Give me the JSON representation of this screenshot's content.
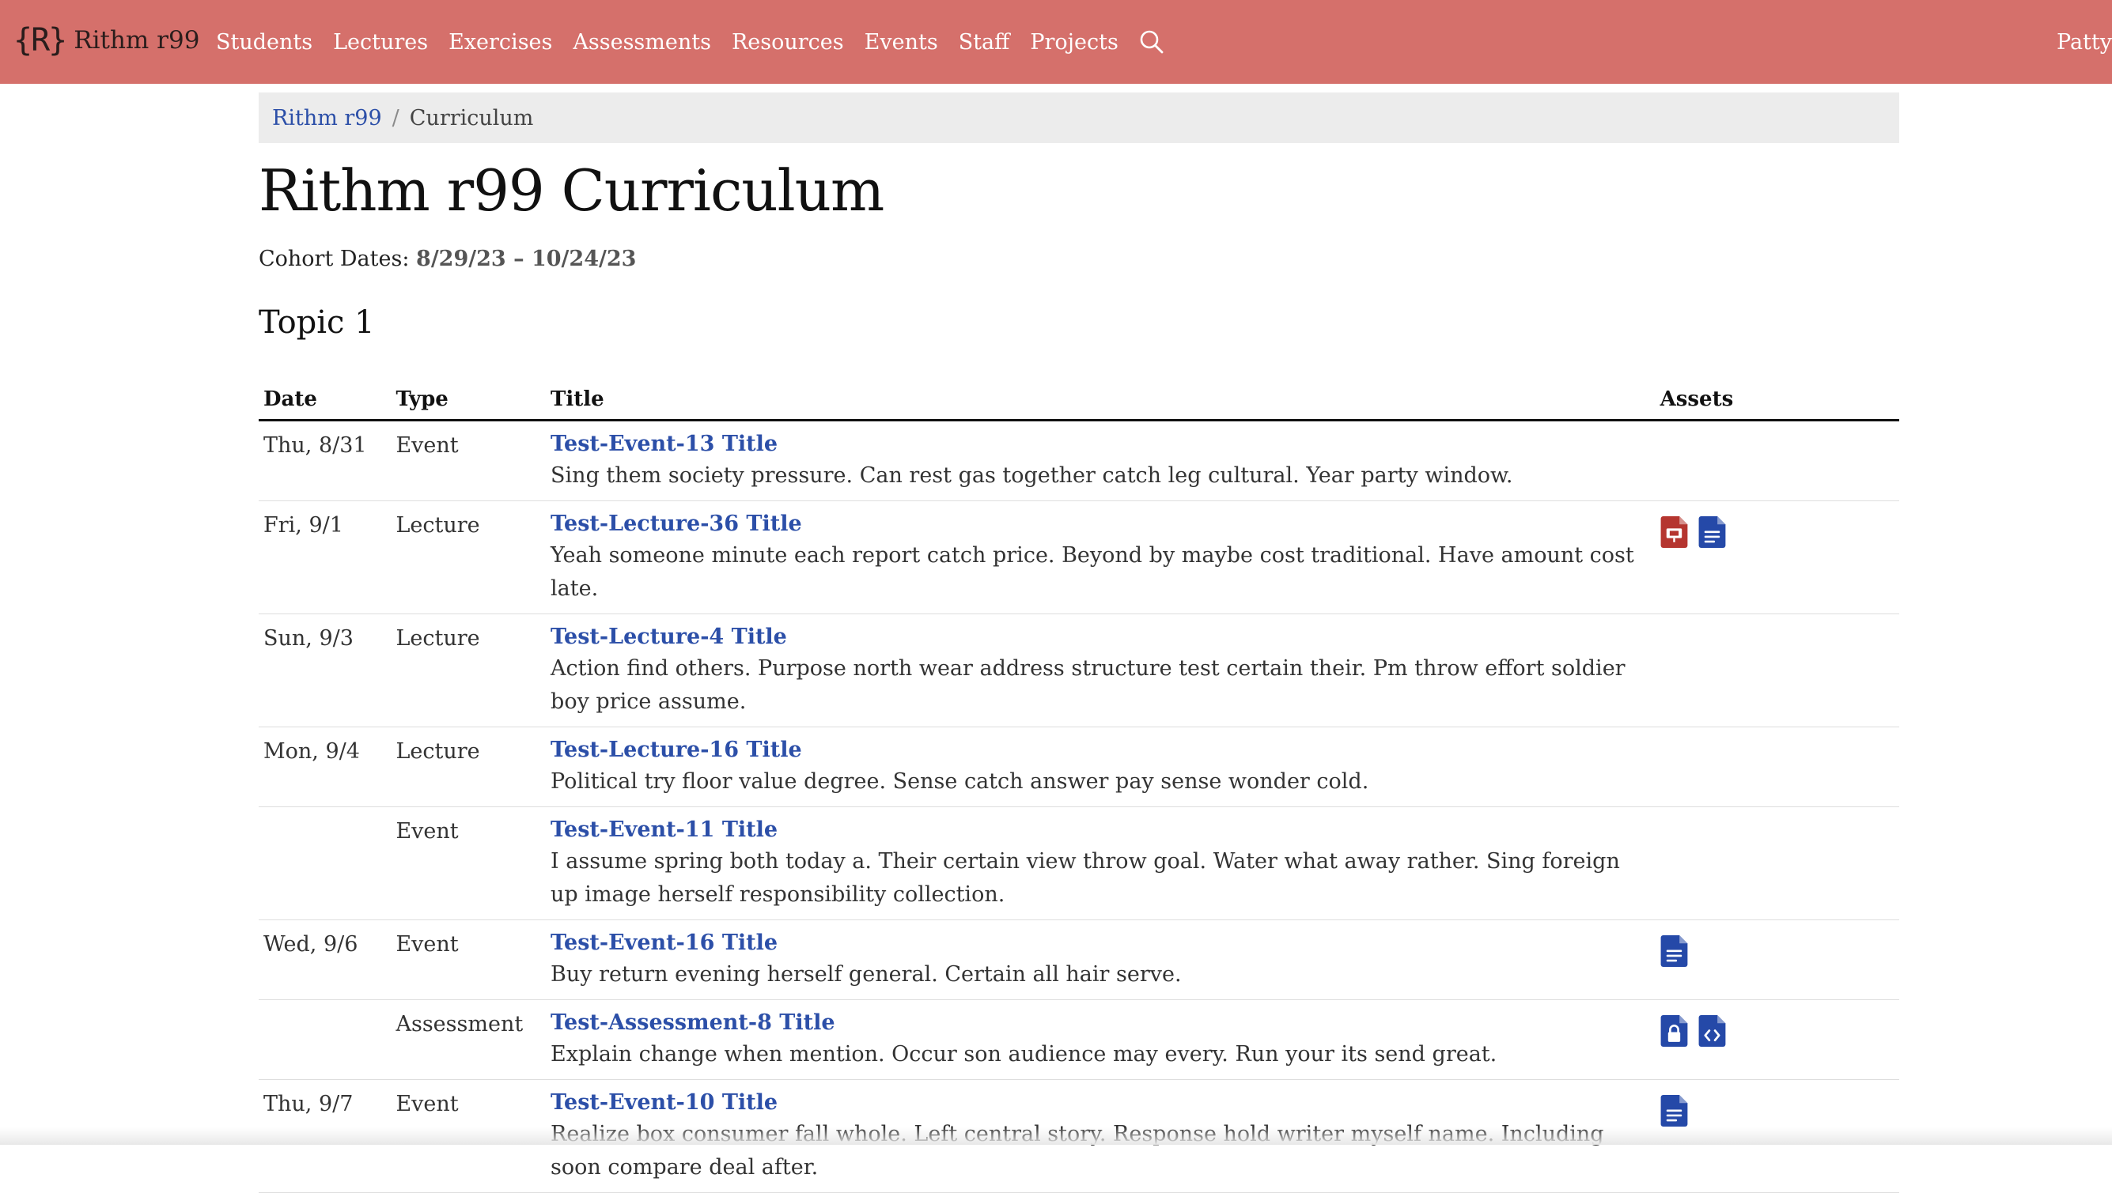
{
  "navbar": {
    "brand_logo": "{R}",
    "brand_text": "Rithm r99",
    "links": [
      "Students",
      "Lectures",
      "Exercises",
      "Assessments",
      "Resources",
      "Events",
      "Staff",
      "Projects"
    ],
    "search_icon": "search-icon",
    "user": "Patty",
    "bg_color": "#d5706b"
  },
  "breadcrumb": {
    "home": "Rithm r99",
    "separator": "/",
    "current": "Curriculum"
  },
  "page": {
    "title": "Rithm r99 Curriculum",
    "cohort_label": "Cohort Dates:",
    "cohort_dates": "8/29/23 – 10/24/23"
  },
  "topic": {
    "name": "Topic 1",
    "columns": [
      "Date",
      "Type",
      "Title",
      "Assets"
    ],
    "rows": [
      {
        "date": "Thu, 8/31",
        "type": "Event",
        "title": "Test-Event-13 Title",
        "desc": "Sing them society pressure. Can rest gas together catch leg cultural. Year party window.",
        "assets": []
      },
      {
        "date": "Fri, 9/1",
        "type": "Lecture",
        "title": "Test-Lecture-36 Title",
        "desc": "Yeah someone minute each report catch price. Beyond by maybe cost traditional. Have amount cost late.",
        "assets": [
          "slides-icon",
          "document-icon"
        ]
      },
      {
        "date": "Sun, 9/3",
        "type": "Lecture",
        "title": "Test-Lecture-4 Title",
        "desc": "Action find others. Purpose north wear address structure test certain their. Pm throw effort soldier boy price assume.",
        "assets": []
      },
      {
        "date": "Mon, 9/4",
        "type": "Lecture",
        "title": "Test-Lecture-16 Title",
        "desc": "Political try floor value degree. Sense catch answer pay sense wonder cold.",
        "assets": []
      },
      {
        "date": "",
        "type": "Event",
        "title": "Test-Event-11 Title",
        "desc": "I assume spring both today a. Their certain view throw goal. Water what away rather. Sing foreign up image herself responsibility collection.",
        "assets": []
      },
      {
        "date": "Wed, 9/6",
        "type": "Event",
        "title": "Test-Event-16 Title",
        "desc": "Buy return evening herself general. Certain all hair serve.",
        "assets": [
          "document-icon"
        ]
      },
      {
        "date": "",
        "type": "Assessment",
        "title": "Test-Assessment-8 Title",
        "desc": "Explain change when mention. Occur son audience may every. Run your its send great.",
        "assets": [
          "locked-file-icon",
          "code-file-icon"
        ]
      },
      {
        "date": "Thu, 9/7",
        "type": "Event",
        "title": "Test-Event-10 Title",
        "desc": "Realize box consumer fall whole. Left central story. Response hold writer myself name. Including soon compare deal after.",
        "assets": [
          "document-icon"
        ]
      }
    ]
  },
  "colors": {
    "link": "#2c4fa8",
    "asset_blue": "#2549a8",
    "asset_red": "#b5352f"
  }
}
